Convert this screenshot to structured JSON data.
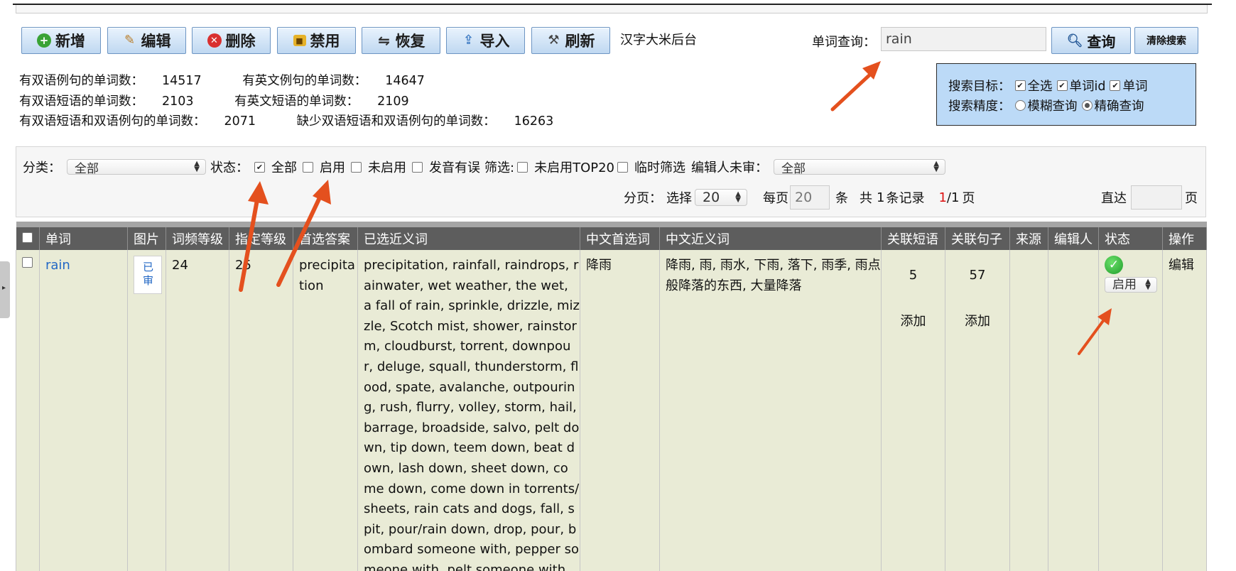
{
  "toolbar": {
    "buttons": [
      "新增",
      "编辑",
      "删除",
      "禁用",
      "恢复",
      "导入",
      "刷新"
    ],
    "brand": "汉字大米后台"
  },
  "search": {
    "label": "单词查询：",
    "value": "rain",
    "button": "查询",
    "clear": "清除搜索"
  },
  "stats": [
    {
      "label": "有双语例句的单词数：",
      "value": "14517"
    },
    {
      "label": "有英文例句的单词数：",
      "value": "14647"
    },
    {
      "label": "有双语短语的单词数：",
      "value": "2103"
    },
    {
      "label": "有英文短语的单词数：",
      "value": "2109"
    },
    {
      "label": "有双语短语和双语例句的单词数：",
      "value": "2071"
    },
    {
      "label": "缺少双语短语和双语例句的单词数：",
      "value": "16263"
    }
  ],
  "search_options": {
    "target_label": "搜索目标：",
    "targets": [
      {
        "label": "全选",
        "checked": true
      },
      {
        "label": "单词id",
        "checked": true
      },
      {
        "label": "单词",
        "checked": true
      }
    ],
    "precision_label": "搜索精度：",
    "precisions": [
      {
        "label": "模糊查询",
        "selected": false
      },
      {
        "label": "精确查询",
        "selected": true
      }
    ]
  },
  "filters": {
    "category_label": "分类：",
    "category_value": "全部",
    "status_label": "状态：",
    "status_options": [
      {
        "label": "全部",
        "checked": true
      },
      {
        "label": "启用",
        "checked": false
      },
      {
        "label": "未启用",
        "checked": false
      },
      {
        "label": "发音有误",
        "checked": false
      }
    ],
    "filter_label": "筛选:",
    "filter_options": [
      {
        "label": "未启用TOP20",
        "checked": false
      },
      {
        "label": "临时筛选",
        "checked": false
      }
    ],
    "editor_label": "编辑人未审：",
    "editor_value": "全部"
  },
  "pagination": {
    "label": "分页：",
    "select_label": "选择",
    "select_value": "20",
    "per_page_label": "每页",
    "per_page_value": "20",
    "per_page_unit": "条",
    "total_prefix": "共",
    "total_count": "1",
    "total_suffix": "条记录",
    "current_page": "1",
    "total_pages": "/1",
    "page_unit": "页",
    "goto_label": "直达",
    "goto_value": "",
    "goto_unit": "页"
  },
  "table": {
    "columns": [
      "单词",
      "图片",
      "词频等级",
      "指定等级",
      "首选答案",
      "已选近义词",
      "中文首选词",
      "中文近义词",
      "关联短语",
      "关联句子",
      "来源",
      "编辑人",
      "状态",
      "操作"
    ],
    "rows": [
      {
        "word": "rain",
        "image": "已审",
        "freq_level": "24",
        "assigned_level": "25",
        "preferred_answer": "precipitation",
        "synonyms": "precipitation, rainfall, raindrops, rainwater, wet weather, the wet, a fall of rain, sprinkle, drizzle, mizzle, Scotch mist, shower, rainstorm, cloudburst, torrent, downpour, deluge, squall, thunderstorm, flood, spate, avalanche, outpouring, rush, flurry, volley, storm, hail, barrage, broadside, salvo, pelt down, tip down, teem down, beat down, lash down, sheet down, come down, come down in torrents/sheets, rain cats and dogs, fall, spit, pour/rain down, drop, pour, bombard someone with, pepper someone with, pelt someone with",
        "cn_preferred": "降雨",
        "cn_synonyms": "降雨, 雨, 雨水, 下雨, 落下, 雨季, 雨点般降落的东西, 大量降落",
        "phrases": "5",
        "phrases_add": "添加",
        "sentences": "57",
        "sentences_add": "添加",
        "source": "",
        "editor": "",
        "status": "启用",
        "action": "编辑"
      }
    ]
  },
  "colors": {
    "accent_arrow": "#e4501e",
    "table_header": "#5d5d5d",
    "row_bg": "#e9ebd6",
    "search_box_bg": "#bcdaf7",
    "link": "#2368c5"
  }
}
